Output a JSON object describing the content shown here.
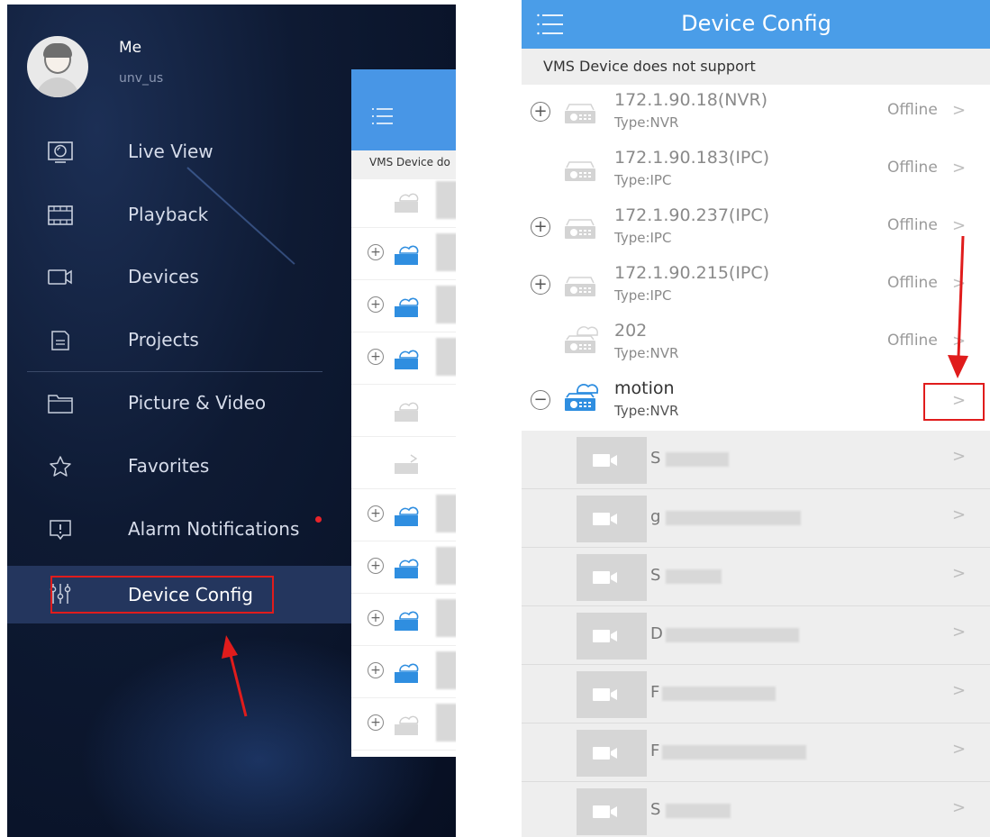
{
  "left": {
    "user": {
      "name": "Me",
      "id": "unv_us"
    },
    "menu": [
      {
        "label": "Live View",
        "icon": "live-view-icon"
      },
      {
        "label": "Playback",
        "icon": "playback-icon"
      },
      {
        "label": "Devices",
        "icon": "devices-icon"
      },
      {
        "label": "Projects",
        "icon": "projects-icon"
      },
      {
        "label": "Picture & Video",
        "icon": "folder-icon"
      },
      {
        "label": "Favorites",
        "icon": "star-icon"
      },
      {
        "label": "Alarm Notifications",
        "icon": "alarm-icon",
        "badge_color": "#e8242a"
      },
      {
        "label": "Device Config",
        "icon": "sliders-icon",
        "active": true
      }
    ],
    "overlay": {
      "notice": "VMS Device do"
    }
  },
  "right": {
    "title": "Device Config",
    "notice": "VMS Device does not support",
    "devices": [
      {
        "name": "172.1.90.18(NVR)",
        "type": "Type:NVR",
        "status": "Offline",
        "expand": "+"
      },
      {
        "name": "172.1.90.183(IPC)",
        "type": "Type:IPC",
        "status": "Offline",
        "expand": ""
      },
      {
        "name": "172.1.90.237(IPC)",
        "type": "Type:IPC",
        "status": "Offline",
        "expand": "+"
      },
      {
        "name": "172.1.90.215(IPC)",
        "type": "Type:IPC",
        "status": "Offline",
        "expand": "+"
      },
      {
        "name": "202",
        "type": "Type:NVR",
        "status": "Offline",
        "expand": ""
      },
      {
        "name": "motion",
        "type": "Type:NVR",
        "status": "",
        "expand": "−"
      }
    ],
    "channels": [
      {
        "name": "S"
      },
      {
        "name": "g"
      },
      {
        "name": "S"
      },
      {
        "name": "D"
      },
      {
        "name": "F"
      },
      {
        "name": "F"
      },
      {
        "name": "S"
      }
    ],
    "chevron": ">"
  },
  "colors": {
    "header_blue": "#4a9de8",
    "highlight_red": "#e01c1c",
    "sidebar_bg": "#0b1630"
  }
}
